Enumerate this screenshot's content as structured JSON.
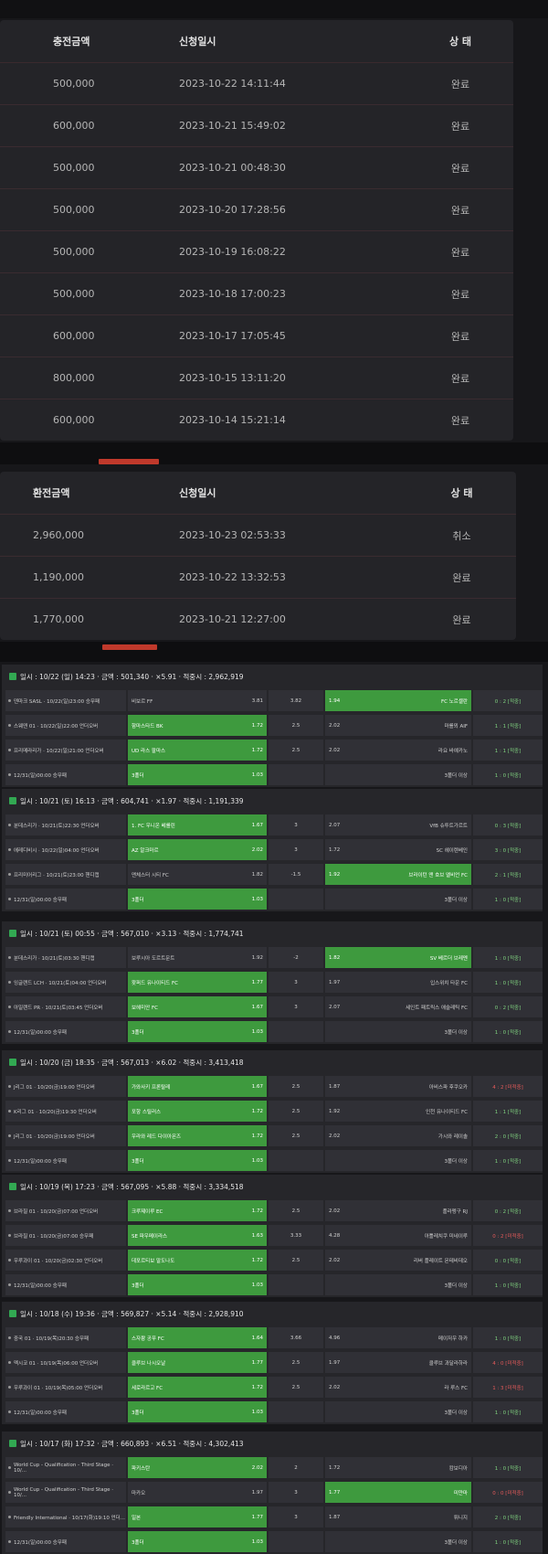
{
  "deposit": {
    "headers": {
      "amount": "충전금액",
      "date": "신청일시",
      "status": "상 태"
    },
    "rows": [
      {
        "amount": "500,000",
        "date": "2023-10-22 14:11:44",
        "status": "완료"
      },
      {
        "amount": "600,000",
        "date": "2023-10-21 15:49:02",
        "status": "완료"
      },
      {
        "amount": "500,000",
        "date": "2023-10-21 00:48:30",
        "status": "완료"
      },
      {
        "amount": "500,000",
        "date": "2023-10-20 17:28:56",
        "status": "완료"
      },
      {
        "amount": "500,000",
        "date": "2023-10-19 16:08:22",
        "status": "완료"
      },
      {
        "amount": "500,000",
        "date": "2023-10-18 17:00:23",
        "status": "완료"
      },
      {
        "amount": "600,000",
        "date": "2023-10-17 17:05:45",
        "status": "완료"
      },
      {
        "amount": "800,000",
        "date": "2023-10-15 13:11:20",
        "status": "완료"
      },
      {
        "amount": "600,000",
        "date": "2023-10-14 15:21:14",
        "status": "완료"
      }
    ]
  },
  "withdraw": {
    "headers": {
      "amount": "환전금액",
      "date": "신청일시",
      "status": "상 태"
    },
    "rows": [
      {
        "amount": "2,960,000",
        "date": "2023-10-23 02:53:33",
        "status": "취소"
      },
      {
        "amount": "1,190,000",
        "date": "2023-10-22 13:32:53",
        "status": "완료"
      },
      {
        "amount": "1,770,000",
        "date": "2023-10-21 12:27:00",
        "status": "완료"
      }
    ]
  },
  "slips": [
    {
      "title": "일시 : 10/22 (일) 14:23 · 금액 : 501,340 · ×5.91 · 적중시 : 2,962,919",
      "rows": [
        {
          "league": "덴마크 SASL · 10/22(일)23:00 승무패",
          "home": "비보르 FF",
          "home_odds": "3.81",
          "draw": "3.82",
          "away": "FC 노르셸란",
          "away_odds": "1.94",
          "result": "0 : 2 [적중]",
          "pick": "away"
        },
        {
          "league": "스웨덴 01 · 10/22(일)22:00 언더오버",
          "home": "함마스타드 BK",
          "home_odds": "1.72",
          "draw": "2.5",
          "away": "마를뫼 AIF",
          "away_odds": "2.02",
          "result": "1 : 1 [적중]",
          "pick": "home"
        },
        {
          "league": "프리메라리가 · 10/22(일)21:00 언더오버",
          "home": "UD 라스 팔마스",
          "home_odds": "1.72",
          "draw": "2.5",
          "away": "라요 바예카노",
          "away_odds": "2.02",
          "result": "1 : 1 [적중]",
          "pick": "home"
        },
        {
          "league": "12/31(일)00:00 승무패",
          "home": "3폴더",
          "home_odds": "1.03",
          "draw": "",
          "away": "3폴더 이상",
          "away_odds": "",
          "result": "1 : 0 [적중]",
          "pick": "home"
        }
      ]
    },
    {
      "title": "일시 : 10/21 (토) 16:13 · 금액 : 604,741 · ×1.97 · 적중시 : 1,191,339",
      "rows": [
        {
          "league": "분데스리가 · 10/21(토)22:30 언더오버",
          "home": "1. FC 우니온 베를린",
          "home_odds": "1.67",
          "draw": "3",
          "away": "VfB 슈투트가르트",
          "away_odds": "2.07",
          "result": "0 : 3 [적중]",
          "pick": "home"
        },
        {
          "league": "에레디비시 · 10/22(일)04:00 언더오버",
          "home": "AZ 알크마르",
          "home_odds": "2.02",
          "draw": "3",
          "away": "SC 헤이렌베인",
          "away_odds": "1.72",
          "result": "3 : 0 [적중]",
          "pick": "home"
        },
        {
          "league": "프리미어리그 · 10/21(토)23:00 핸디캡",
          "home": "맨체스터 시티 FC",
          "home_odds": "1.82",
          "draw": "-1.5",
          "away": "브라이턴 앤 호브 앨비언 FC",
          "away_odds": "1.92",
          "result": "2 : 1 [적중]",
          "pick": "away"
        },
        {
          "league": "12/31(일)00:00 승무패",
          "home": "3폴더",
          "home_odds": "1.03",
          "draw": "",
          "away": "3폴더 이상",
          "away_odds": "",
          "result": "1 : 0 [적중]",
          "pick": "home"
        }
      ]
    },
    {
      "title": "일시 : 10/21 (토) 00:55 · 금액 : 567,010 · ×3.13 · 적중시 : 1,774,741",
      "rows": [
        {
          "league": "분데스리가 · 10/21(토)03:30 핸디캡",
          "home": "보루시아 도르트문트",
          "home_odds": "1.92",
          "draw": "-2",
          "away": "SV 베르더 브레멘",
          "away_odds": "1.82",
          "result": "1 : 0 [적중]",
          "pick": "away"
        },
        {
          "league": "잉글랜드 LCH · 10/21(토)04:00 언더오버",
          "home": "왓퍼드 유나이티드 FC",
          "home_odds": "1.77",
          "draw": "3",
          "away": "입스위치 타운 FC",
          "away_odds": "1.97",
          "result": "1 : 0 [적중]",
          "pick": "home"
        },
        {
          "league": "아일랜드 PR · 10/21(토)03:45 언더오버",
          "home": "보헤미안 FC",
          "home_odds": "1.67",
          "draw": "3",
          "away": "세인트 패트릭스 애슬레틱 FC",
          "away_odds": "2.07",
          "result": "0 : 2 [적중]",
          "pick": "home"
        },
        {
          "league": "12/31(일)00:00 승무패",
          "home": "3폴더",
          "home_odds": "1.03",
          "draw": "",
          "away": "3폴더 이상",
          "away_odds": "",
          "result": "1 : 0 [적중]",
          "pick": "home"
        }
      ]
    },
    {
      "title": "일시 : 10/20 (금) 18:35 · 금액 : 567,013 · ×6.02 · 적중시 : 3,413,418",
      "rows": [
        {
          "league": "J리그 01 · 10/20(금)19:00 언더오버",
          "home": "가와사키 프론탈레",
          "home_odds": "1.67",
          "draw": "2.5",
          "away": "아비스파 후쿠오카",
          "away_odds": "1.87",
          "result": "4 : 2 [미적중]",
          "pick": "home"
        },
        {
          "league": "K리그 01 · 10/20(금)19:30 언더오버",
          "home": "포항 스틸러스",
          "home_odds": "1.72",
          "draw": "2.5",
          "away": "인천 유나이티드 FC",
          "away_odds": "1.92",
          "result": "1 : 1 [적중]",
          "pick": "home"
        },
        {
          "league": "J리그 01 · 10/20(금)19:00 언더오버",
          "home": "우라와 레드 다이아몬즈",
          "home_odds": "1.72",
          "draw": "2.5",
          "away": "가시와 레이솔",
          "away_odds": "2.02",
          "result": "2 : 0 [적중]",
          "pick": "home"
        },
        {
          "league": "12/31(일)00:00 승무패",
          "home": "3폴더",
          "home_odds": "1.03",
          "draw": "",
          "away": "3폴더 이상",
          "away_odds": "",
          "result": "1 : 0 [적중]",
          "pick": "home"
        }
      ]
    },
    {
      "title": "일시 : 10/19 (목) 17:23 · 금액 : 567,095 · ×5.88 · 적중시 : 3,334,518",
      "rows": [
        {
          "league": "브라질 01 · 10/20(금)07:00 언더오버",
          "home": "크루제이루 EC",
          "home_odds": "1.72",
          "draw": "2.5",
          "away": "플라멩구 RJ",
          "away_odds": "2.02",
          "result": "0 : 2 [적중]",
          "pick": "home"
        },
        {
          "league": "브라질 01 · 10/20(금)07:00 승무패",
          "home": "SE 파우메이라스",
          "home_odds": "1.63",
          "draw": "3.33",
          "away": "아틀레치쿠 미네이루",
          "away_odds": "4.28",
          "result": "0 : 2 [미적중]",
          "pick": "home"
        },
        {
          "league": "우루과이 01 · 10/20(금)02:30 언더오버",
          "home": "데포르티보 말도나도",
          "home_odds": "1.72",
          "draw": "2.5",
          "away": "리버 플레이트 몬테비데오",
          "away_odds": "2.02",
          "result": "0 : 0 [적중]",
          "pick": "home"
        },
        {
          "league": "12/31(일)00:00 승무패",
          "home": "3폴더",
          "home_odds": "1.03",
          "draw": "",
          "away": "3폴더 이상",
          "away_odds": "",
          "result": "1 : 0 [적중]",
          "pick": "home"
        }
      ]
    },
    {
      "title": "일시 : 10/18 (수) 19:36 · 금액 : 569,827 · ×5.14 · 적중시 : 2,928,910",
      "rows": [
        {
          "league": "중국 01 · 10/19(목)20:30 승무패",
          "home": "스자좡 공푸 FC",
          "home_odds": "1.64",
          "draw": "3.66",
          "away": "메이저우 하카",
          "away_odds": "4.96",
          "result": "1 : 0 [적중]",
          "pick": "home"
        },
        {
          "league": "멕시코 01 · 10/19(목)06:00 언더오버",
          "home": "클루브 나시오날",
          "home_odds": "1.77",
          "draw": "2.5",
          "away": "클루브 과달라하라",
          "away_odds": "1.97",
          "result": "4 : 0 [미적중]",
          "pick": "home"
        },
        {
          "league": "우루과이 01 · 10/19(목)05:00 언더오버",
          "home": "세로라르고 FC",
          "home_odds": "1.72",
          "draw": "2.5",
          "away": "라 루스 FC",
          "away_odds": "2.02",
          "result": "1 : 3 [미적중]",
          "pick": "home"
        },
        {
          "league": "12/31(일)00:00 승무패",
          "home": "3폴더",
          "home_odds": "1.03",
          "draw": "",
          "away": "3폴더 이상",
          "away_odds": "",
          "result": "1 : 0 [적중]",
          "pick": "home"
        }
      ]
    },
    {
      "title": "일시 : 10/17 (화) 17:32 · 금액 : 660,893 · ×6.51 · 적중시 : 4,302,413",
      "rows": [
        {
          "league": "World Cup - Qualification - Third Stage · 10/...",
          "home": "파키스탄",
          "home_odds": "2.02",
          "draw": "2",
          "away": "캄보디아",
          "away_odds": "1.72",
          "result": "1 : 0 [적중]",
          "pick": "home"
        },
        {
          "league": "World Cup - Qualification - Third Stage · 10/...",
          "home": "마카오",
          "home_odds": "1.97",
          "draw": "3",
          "away": "미얀마",
          "away_odds": "1.77",
          "result": "0 : 0 [미적중]",
          "pick": "away"
        },
        {
          "league": "Friendly International · 10/17(화)19:10 언더...",
          "home": "일본",
          "home_odds": "1.77",
          "draw": "3",
          "away": "튀니지",
          "away_odds": "1.87",
          "result": "2 : 0 [적중]",
          "pick": "home"
        },
        {
          "league": "12/31(일)00:00 승무패",
          "home": "3폴더",
          "home_odds": "1.03",
          "draw": "",
          "away": "3폴더 이상",
          "away_odds": "",
          "result": "1 : 0 [적중]",
          "pick": "home"
        }
      ]
    }
  ]
}
